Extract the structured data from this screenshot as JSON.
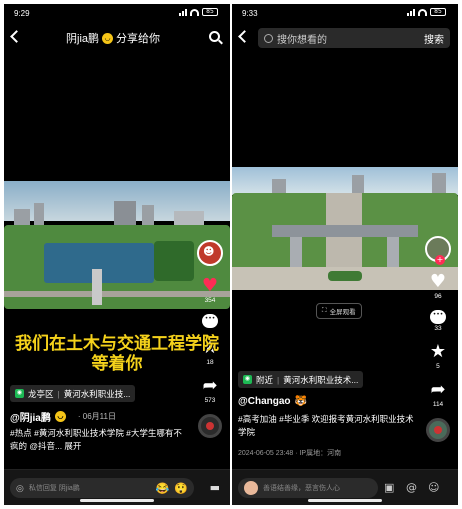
{
  "left": {
    "status": {
      "time": "9:29",
      "battery": "85"
    },
    "header": {
      "title": "阴jia鹏",
      "suffix": "分享给你"
    },
    "overlay_title": "我们在土木与交通工程学院等着你",
    "actions": {
      "likes": "354",
      "stars": "18",
      "shares": "573"
    },
    "location": {
      "prefix": "龙亭区",
      "name": "黄河水利职业技..."
    },
    "author": {
      "handle": "@阴jia鹏",
      "date": "· 06月11日"
    },
    "caption": "#热点 #黄河水利职业技术学院 #大学生哪有不疯的 @抖音... 展开",
    "reply_placeholder": "私信回复 阴jia鹏",
    "accent": "#fe2c55"
  },
  "right": {
    "status": {
      "time": "9:33",
      "battery": "85"
    },
    "search": {
      "placeholder": "搜你想看的",
      "button": "搜索"
    },
    "fullscreen_label": "全屏观看",
    "actions": {
      "likes": "96",
      "comments": "33",
      "stars": "5",
      "shares": "114"
    },
    "location": {
      "prefix": "附近",
      "name": "黄河水利职业技术..."
    },
    "author": {
      "handle": "@Changao"
    },
    "caption": "#高考加油 #毕业季 欢迎报考黄河水利职业技术学院",
    "meta": "2024-06-05 23:48 · IP属地：河南",
    "comment_placeholder": "善语结善缘，恶言伤人心",
    "accent": "#fe2c55"
  }
}
